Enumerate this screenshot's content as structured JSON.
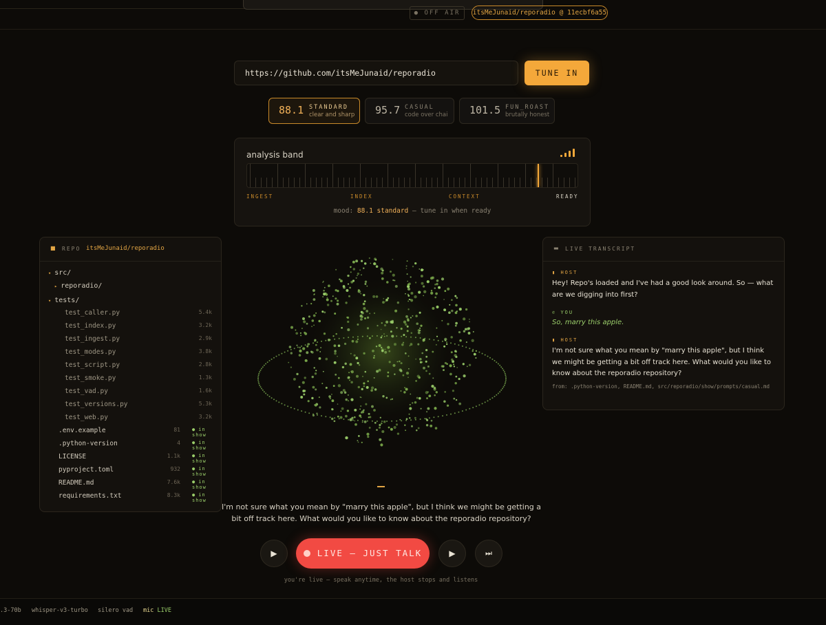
{
  "topbar": {
    "onair_label": "● OFF AIR",
    "repo_pill": "itsMeJunaid/reporadio @ 11ecbf6a55"
  },
  "tuner": {
    "url_value": "https://github.com/itsMeJunaid/reporadio",
    "tune_label": "TUNE IN"
  },
  "stations": [
    {
      "freq": "88.1",
      "name": "STANDARD",
      "sub": "clear and sharp",
      "active": true
    },
    {
      "freq": "95.7",
      "name": "CASUAL",
      "sub": "code over chai",
      "active": false
    },
    {
      "freq": "101.5",
      "name": "FUN_ROAST",
      "sub": "brutally honest",
      "active": false
    }
  ],
  "analysis": {
    "title": "analysis band",
    "stages": [
      "INGEST",
      "INDEX",
      "CONTEXT",
      "READY"
    ],
    "mood_prefix": "mood:",
    "mood_value": "88.1 standard",
    "mood_suffix": "— tune in when ready",
    "signal_icon": "signal-bars-icon"
  },
  "repo": {
    "label": "REPO",
    "name": "itsMeJunaid/reporadio",
    "dirs": [
      "src/",
      "reporadio/",
      "tests/"
    ],
    "test_files": [
      {
        "name": "test_caller.py",
        "size": "5.4k"
      },
      {
        "name": "test_index.py",
        "size": "3.2k"
      },
      {
        "name": "test_ingest.py",
        "size": "2.9k"
      },
      {
        "name": "test_modes.py",
        "size": "3.8k"
      },
      {
        "name": "test_script.py",
        "size": "2.8k"
      },
      {
        "name": "test_smoke.py",
        "size": "1.3k"
      },
      {
        "name": "test_vad.py",
        "size": "1.6k"
      },
      {
        "name": "test_versions.py",
        "size": "5.3k"
      },
      {
        "name": "test_web.py",
        "size": "3.2k"
      }
    ],
    "root_files": [
      {
        "name": ".env.example",
        "size": "81",
        "badge": "in show"
      },
      {
        "name": ".python-version",
        "size": "4",
        "badge": "in show"
      },
      {
        "name": "LICENSE",
        "size": "1.1k",
        "badge": "in show"
      },
      {
        "name": "pyproject.toml",
        "size": "932",
        "badge": "in show"
      },
      {
        "name": "README.md",
        "size": "7.6k",
        "badge": "in show"
      },
      {
        "name": "requirements.txt",
        "size": "8.3k",
        "badge": "in show"
      }
    ]
  },
  "transcript": {
    "label": "LIVE TRANSCRIPT",
    "host_label": "HOST",
    "you_label": "YOU",
    "msg1": "Hey! Repo's loaded and I've had a good look around. So — what are we digging into first?",
    "msg2": "So, marry this apple.",
    "msg3": "I'm not sure what you mean by \"marry this apple\", but I think we might be getting a bit off track here. What would you like to know about the reporadio repository?",
    "source": "from: .python-version, README.md, src/reporadio/show/prompts/casual.md"
  },
  "caption": "I'm not sure what you mean by \"marry this apple\", but I think we might be getting a bit off track here. What would you like to know about the reporadio repository?",
  "controls": {
    "play_glyph": "▶",
    "next_glyph": "⏭",
    "live_label": "LIVE — JUST TALK",
    "hint": "you're live — speak anytime, the host stops and listens"
  },
  "status": {
    "model": ".3-70b",
    "stt": "whisper-v3-turbo",
    "vad": "silero vad",
    "mic_prefix": "mic",
    "mic_state": "LIVE"
  },
  "colors": {
    "accent": "#f4a83a",
    "live": "#f24a43",
    "green": "#9acd6a"
  }
}
